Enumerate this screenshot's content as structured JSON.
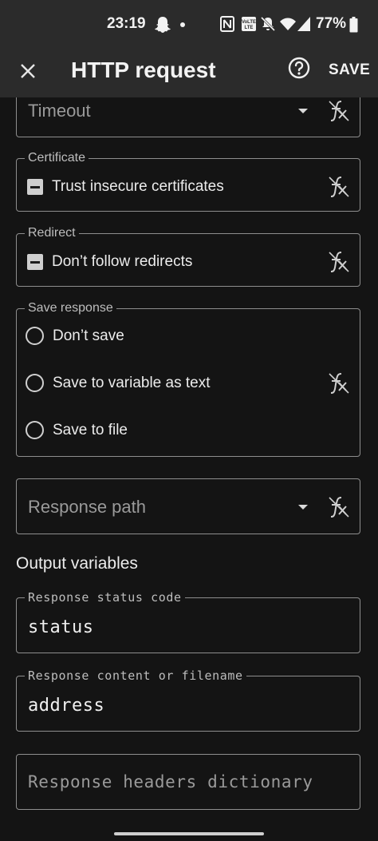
{
  "status_bar": {
    "time": "23:19",
    "battery": "77%",
    "icons": [
      "snapchat-ghost-icon",
      "dot-icon",
      "nfc-icon",
      "volte-icon",
      "bell-off-icon",
      "wifi-icon",
      "signal-icon",
      "battery-icon"
    ]
  },
  "app_bar": {
    "title": "HTTP request",
    "save_label": "SAVE",
    "close_icon": "close-icon",
    "help_icon": "help-circle-icon"
  },
  "fields": {
    "timeout": {
      "placeholder": "Timeout"
    },
    "certificate": {
      "legend": "Certificate",
      "option": "Trust insecure certificates"
    },
    "redirect": {
      "legend": "Redirect",
      "option": "Don’t follow redirects"
    },
    "save_response": {
      "legend": "Save response",
      "options": [
        "Don’t save",
        "Save to variable as text",
        "Save to file"
      ]
    },
    "response_path": {
      "placeholder": "Response path"
    }
  },
  "output_variables": {
    "title": "Output variables",
    "status_code": {
      "legend": "Response status code",
      "value": "status"
    },
    "content": {
      "legend": "Response content or filename",
      "value": "address"
    },
    "headers": {
      "placeholder": "Response headers dictionary"
    }
  },
  "colors": {
    "background": "#141414",
    "bar": "#2b2b2b",
    "border": "#8e8e8e",
    "text": "#ececec"
  }
}
